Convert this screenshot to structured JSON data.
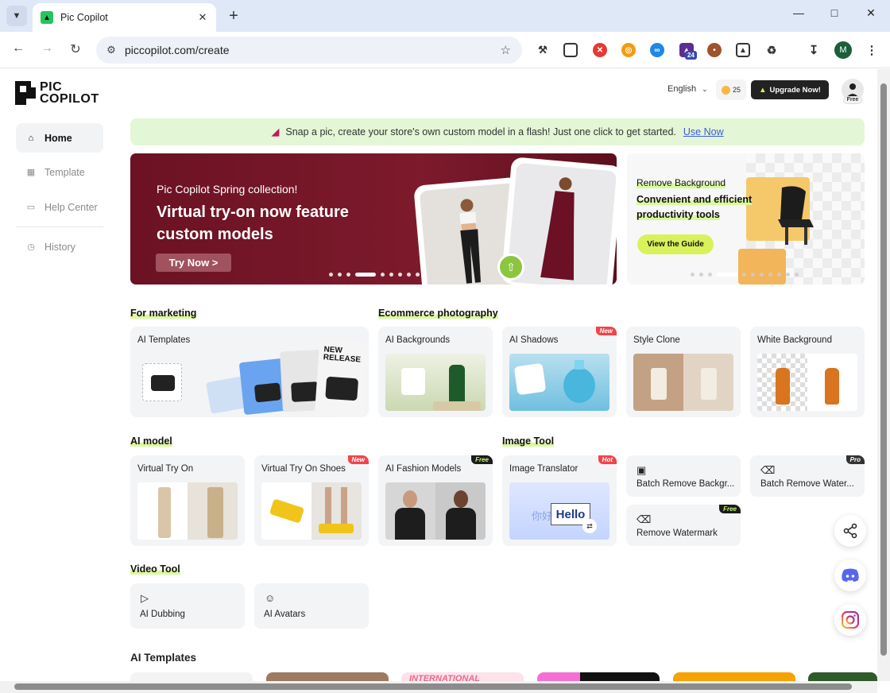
{
  "browser": {
    "tab_title": "Pic Copilot",
    "url": "piccopilot.com/create",
    "profile_initial": "M",
    "ext_badge": "24"
  },
  "brand": {
    "line1": "PIC",
    "line2": "COPILOT"
  },
  "header": {
    "language": "English",
    "credits": "25",
    "upgrade": "Upgrade Now!",
    "plan": "Free"
  },
  "sidebar": {
    "items": [
      {
        "label": "Home"
      },
      {
        "label": "Template"
      },
      {
        "label": "Help Center"
      },
      {
        "label": "History"
      }
    ]
  },
  "banner": {
    "text": "Snap a pic, create your store's own custom model in a flash! Just one click to get started.",
    "link": "Use Now"
  },
  "hero": {
    "subtitle": "Pic Copilot Spring collection!",
    "headline": "Virtual try-on now feature custom models",
    "cta": "Try Now >"
  },
  "hero2": {
    "title": "Remove Background",
    "tagline": "Convenient and efficient productivity tools",
    "cta": "View the Guide"
  },
  "sections": {
    "marketing": "For marketing",
    "ecommerce": "Ecommerce photography",
    "ai_model": "AI model",
    "image_tool": "Image Tool",
    "video_tool": "Video Tool"
  },
  "cards": {
    "ai_templates": "AI Templates",
    "ai_backgrounds": "AI Backgrounds",
    "ai_shadows": "AI Shadows",
    "style_clone": "Style Clone",
    "white_background": "White Background",
    "virtual_try_on": "Virtual Try On",
    "virtual_try_on_shoes": "Virtual Try On Shoes",
    "ai_fashion_models": "AI Fashion Models",
    "image_translator": "Image Translator",
    "batch_remove_bg": "Batch Remove Backgr...",
    "batch_remove_water": "Batch Remove Water...",
    "remove_watermark": "Remove Watermark",
    "ai_dubbing": "AI Dubbing",
    "ai_avatars": "AI Avatars"
  },
  "badges": {
    "new": "New",
    "free": "Free",
    "hot": "Hot",
    "pro": "Pro"
  },
  "thumb_text": {
    "new_release_1": "NEW",
    "new_release_2": "RELEASE",
    "hello": "Hello",
    "chinese": "你好"
  },
  "bottom": {
    "title": "AI Templates",
    "strip_text": "INTERNATIONAL"
  },
  "colors": {
    "accent_green": "#d9f99d",
    "hero_bg": "#6b1223",
    "badge_red": "#f0444a",
    "link_blue": "#3b5bdb"
  }
}
